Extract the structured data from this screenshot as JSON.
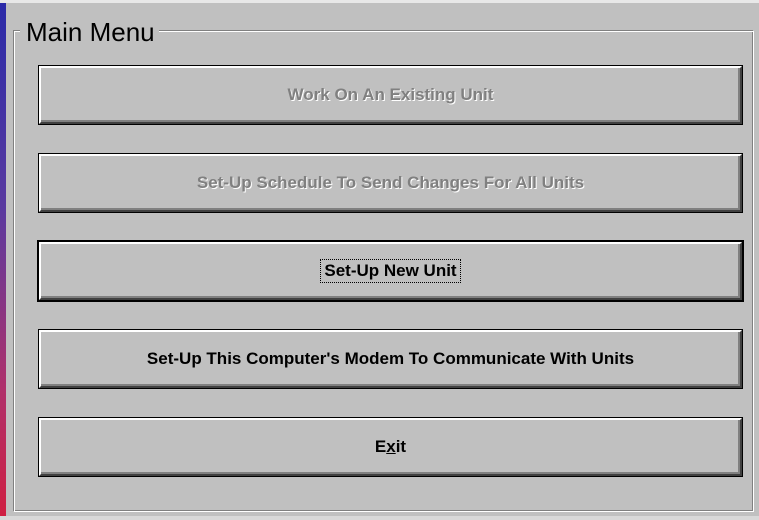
{
  "window": {
    "group_title": "Main Menu"
  },
  "buttons": [
    {
      "label": "Work On An Existing Unit",
      "enabled": false
    },
    {
      "label": "Set-Up Schedule To Send Changes For All Units",
      "enabled": false
    },
    {
      "label": "Set-Up New Unit",
      "enabled": true,
      "focused": true
    },
    {
      "label": "Set-Up This Computer's Modem To Communicate With Units",
      "enabled": true
    },
    {
      "label": "Exit",
      "enabled": true,
      "mnemonic": "x"
    }
  ],
  "colors": {
    "face": "#c0c0c0",
    "disabled_text": "#808080"
  }
}
